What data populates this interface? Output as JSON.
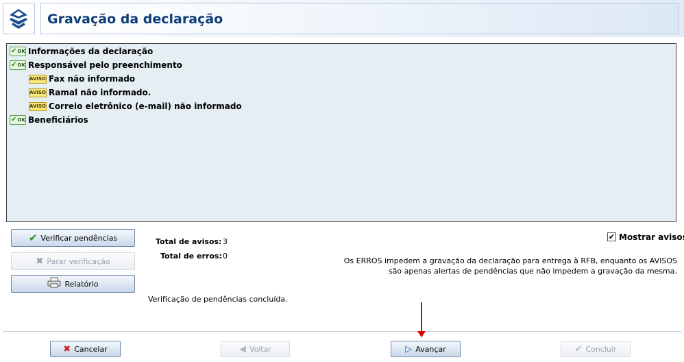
{
  "header": {
    "title": "Gravação da declaração",
    "logo_icon": "receita-federal-logo-icon"
  },
  "tree": [
    {
      "status": "OK",
      "label": "Informações da declaração",
      "level": 0
    },
    {
      "status": "OK",
      "label": "Responsável pelo preenchimento",
      "level": 0
    },
    {
      "status": "AVISO",
      "label": "Fax não informado",
      "level": 1
    },
    {
      "status": "AVISO",
      "label": "Ramal não informado.",
      "level": 1
    },
    {
      "status": "AVISO",
      "label": "Correio eletrônico (e-mail) não informado",
      "level": 1
    },
    {
      "status": "OK",
      "label": "Beneficiários",
      "level": 0
    }
  ],
  "badges": {
    "ok": "OK",
    "aviso": "AVISO"
  },
  "actions": {
    "verificar": "Verificar pendências",
    "parar": "Parar verificação",
    "relatorio": "Relatório"
  },
  "totals": {
    "avisos_label": "Total de avisos:",
    "avisos_value": "3",
    "erros_label": "Total de erros:",
    "erros_value": "0"
  },
  "status_text": "Verificação de pendências concluída.",
  "mostrar_avisos": {
    "label": "Mostrar avisos",
    "checked": true
  },
  "note": {
    "line1": "Os ERROS impedem a gravação da declaração para entrega à RFB, enquanto os AVISOS",
    "line2": "são apenas alertas de pendências que não impedem a gravação da mesma."
  },
  "footer": {
    "cancelar": "Cancelar",
    "voltar": "Voltar",
    "avancar": "Avançar",
    "concluir": "Concluir"
  },
  "colors": {
    "title": "#0f3d78",
    "tree_bg": "#e4eef3",
    "arrow": "#e00000",
    "aviso": "#f8e67a",
    "ok": "#e8f6e4"
  }
}
